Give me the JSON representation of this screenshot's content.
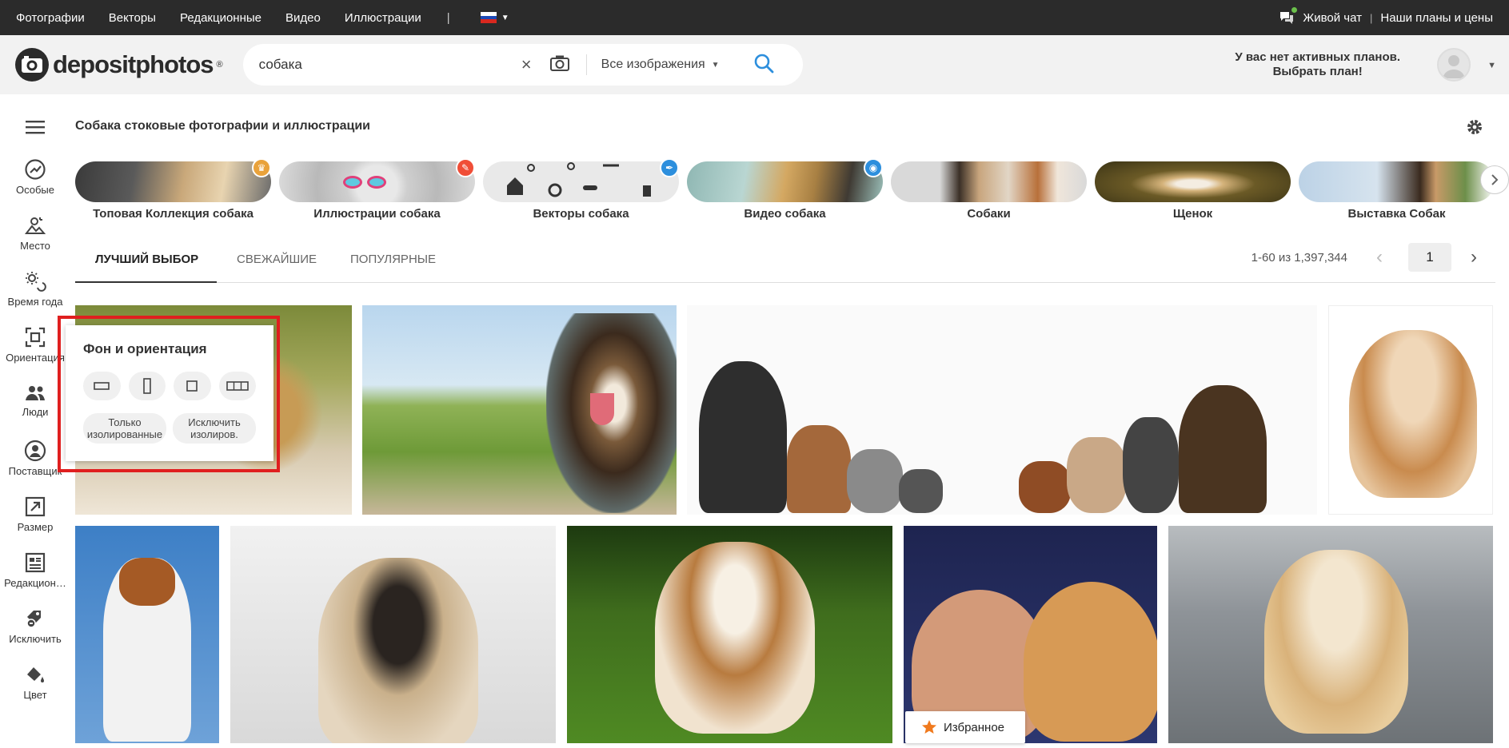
{
  "topbar": {
    "nav": [
      "Фотографии",
      "Векторы",
      "Редакционные",
      "Видео",
      "Иллюстрации"
    ],
    "separator": "|",
    "live_chat": "Живой чат",
    "divider": "|",
    "plans_link": "Наши планы и цены"
  },
  "header": {
    "logo": "depositphotos",
    "logo_mark": "®",
    "search_query": "собака",
    "search_type": "Все изображения",
    "plans_line1": "У вас нет активных планов.",
    "plans_line2": "Выбрать план!"
  },
  "sidebar": {
    "items": [
      {
        "label": "Особые",
        "icon": "trending-icon"
      },
      {
        "label": "Место",
        "icon": "location-icon"
      },
      {
        "label": "Время года",
        "icon": "season-icon"
      },
      {
        "label": "Ориентация",
        "icon": "orientation-icon"
      },
      {
        "label": "Люди",
        "icon": "people-icon"
      },
      {
        "label": "Поставщик",
        "icon": "contributor-icon"
      },
      {
        "label": "Размер",
        "icon": "size-icon"
      },
      {
        "label": "Редакцион…",
        "icon": "editorial-icon"
      },
      {
        "label": "Исключить",
        "icon": "exclude-icon"
      },
      {
        "label": "Цвет",
        "icon": "color-icon"
      }
    ]
  },
  "page_title": "Собака стоковые фотографии и иллюстрации",
  "categories": [
    {
      "label": "Топовая Коллекция собака",
      "badge": "crown-icon",
      "badge_color": "#e9a23b"
    },
    {
      "label": "Иллюстрации собака",
      "badge": "brush-icon",
      "badge_color": "#f04e37"
    },
    {
      "label": "Векторы собака",
      "badge": "pen-icon",
      "badge_color": "#2d8fdd"
    },
    {
      "label": "Видео собака",
      "badge": "camera-icon",
      "badge_color": "#2d8fdd"
    },
    {
      "label": "Собаки",
      "badge": "",
      "badge_color": ""
    },
    {
      "label": "Щенок",
      "badge": "",
      "badge_color": ""
    },
    {
      "label": "Выставка Собак",
      "badge": "",
      "badge_color": ""
    }
  ],
  "tabs": [
    "ЛУЧШИЙ ВЫБОР",
    "СВЕЖАЙШИЕ",
    "ПОПУЛЯРНЫЕ"
  ],
  "results": "1-60 из 1,397,344",
  "page_number": "1",
  "popup": {
    "title": "Фон и ориентация",
    "isolated_only": [
      "Только",
      "изолированные"
    ],
    "exclude_isolated": [
      "Исключить",
      "изолиров."
    ]
  },
  "favorites_label": "Избранное",
  "colors": {
    "topbar": "#2b2b2b",
    "header": "#f2f2f2",
    "search_blue": "#2d8fdd",
    "highlight_red": "#e01f1f",
    "favorite_star": "#f07a1e"
  }
}
